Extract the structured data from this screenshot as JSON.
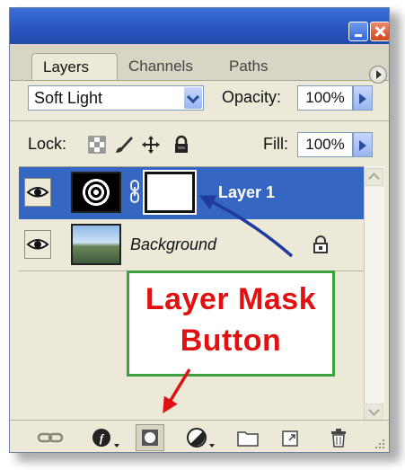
{
  "tabs": [
    {
      "label": "Layers"
    },
    {
      "label": "Channels"
    },
    {
      "label": "Paths"
    }
  ],
  "blend_mode": "Soft Light",
  "opacity": {
    "label": "Opacity:",
    "value": "100%"
  },
  "lock": {
    "label": "Lock:"
  },
  "fill": {
    "label": "Fill:",
    "value": "100%"
  },
  "layers": [
    {
      "name": "Layer 1",
      "selected": true,
      "has_mask": true
    },
    {
      "name": "Background",
      "selected": false,
      "locked": true
    }
  ],
  "callout": {
    "line1": "Layer Mask",
    "line2": "Button"
  },
  "colors": {
    "titlebar": "#2a57c0",
    "selected_row": "#3466c2",
    "callout_text": "#e11111",
    "callout_border": "#40a040",
    "annotation_arrow_blue": "#1f3aa0",
    "annotation_arrow_red": "#e11111"
  },
  "footer_buttons": [
    "link-layers-icon",
    "layer-style-icon",
    "add-layer-mask-icon",
    "adjustment-layer-icon",
    "new-group-icon",
    "new-layer-icon",
    "trash-icon"
  ]
}
